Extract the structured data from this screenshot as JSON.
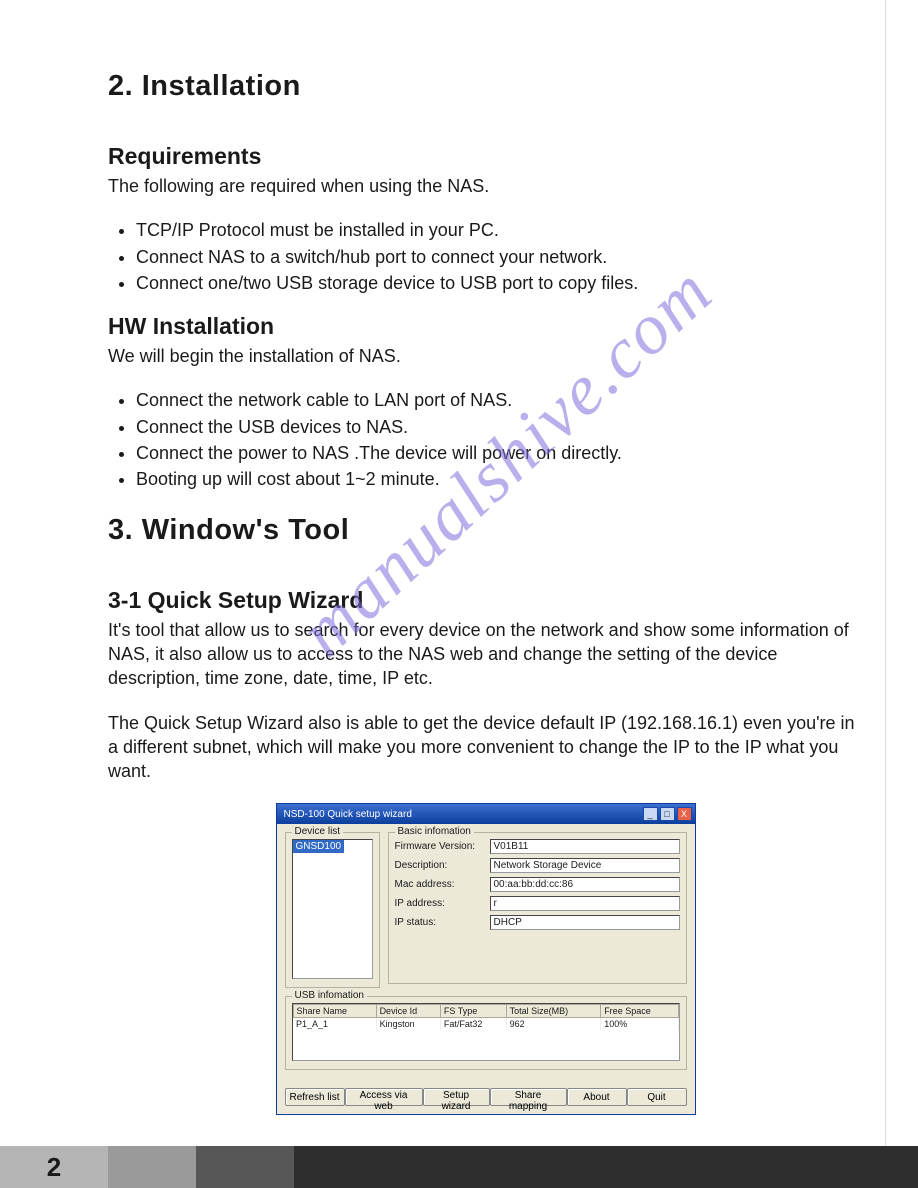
{
  "watermark": "manualshive.com",
  "section2": {
    "heading": "2. Installation",
    "req_heading": "Requirements",
    "req_intro": "The following are required when using the NAS.",
    "req_items": [
      "TCP/IP Protocol must be installed in your PC.",
      "Connect NAS to a switch/hub port to connect your network.",
      "Connect one/two USB storage device to USB port to copy files."
    ],
    "hw_heading": "HW Installation",
    "hw_intro": "We will begin the installation of NAS.",
    "hw_items": [
      "Connect the network cable to LAN port of NAS.",
      "Connect the USB devices to NAS.",
      "Connect the power to NAS .The device will power on directly.",
      "Booting up will cost about 1~2 minute."
    ]
  },
  "section3": {
    "heading": "3.  Window's Tool",
    "sub_heading": "3-1  Quick Setup Wizard",
    "para1": "It's tool that allow us to search for every device on the network and show some information of NAS, it also allow us to access to the NAS web and change the setting of the device description, time zone, date, time, IP etc.",
    "para2": "The Quick Setup Wizard also is able to get the device default IP (192.168.16.1) even you're in a different subnet, which will make you more convenient to change the IP to the IP what you want."
  },
  "dialog": {
    "title": "NSD-100 Quick setup wizard",
    "device_list_label": "Device list",
    "device_selected": "GNSD100",
    "basic_label": "Basic infomation",
    "rows": {
      "fw_label": "Firmware Version:",
      "fw_val": "V01B11",
      "desc_label": "Description:",
      "desc_val": "Network Storage Device",
      "mac_label": "Mac address:",
      "mac_val": "00:aa:bb:dd:cc:86",
      "ip_label": "IP address:",
      "ip_val": "r",
      "ipstat_label": "IP status:",
      "ipstat_val": "DHCP"
    },
    "usb_label": "USB infomation",
    "usb_headers": [
      "Share Name",
      "Device Id",
      "FS Type",
      "Total Size(MB)",
      "Free Space"
    ],
    "usb_row": [
      "P1_A_1",
      "Kingston",
      "Fat/Fat32",
      "962",
      "100%"
    ],
    "buttons": {
      "refresh": "Refresh list",
      "access": "Access via web",
      "setup": "Setup wizard",
      "share": "Share mapping",
      "about": "About",
      "quit": "Quit"
    }
  },
  "page_number": "2"
}
